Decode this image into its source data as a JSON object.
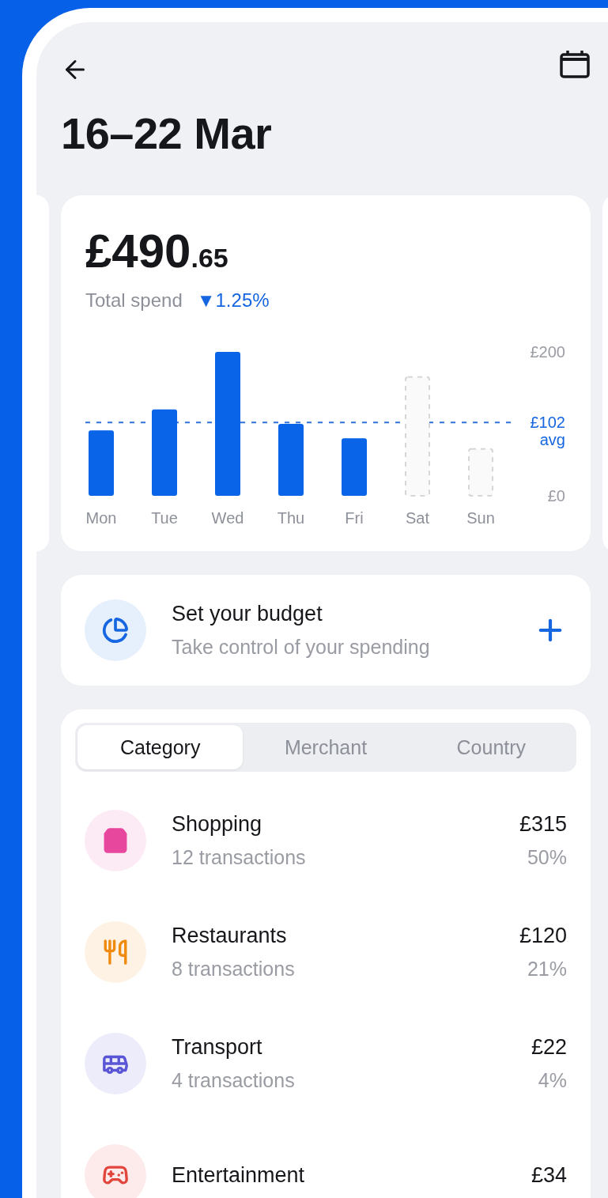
{
  "header": {
    "title": "16–22 Mar"
  },
  "summary": {
    "amount_main": "£490",
    "amount_cents": ".65",
    "label": "Total spend",
    "change": "▼1.25%",
    "chart_data": {
      "type": "bar",
      "categories": [
        "Mon",
        "Tue",
        "Wed",
        "Thu",
        "Fri",
        "Sat",
        "Sun"
      ],
      "ylim": [
        0,
        200
      ],
      "yticks": [
        {
          "value": 0,
          "label": "£0"
        },
        {
          "value": 102,
          "label": "£102"
        },
        {
          "value": 200,
          "label": "£200"
        }
      ],
      "series": [
        {
          "color": "#0a64e8",
          "values": [
            91,
            120,
            200,
            100,
            80,
            null,
            null
          ]
        },
        {
          "color": "#d6d6d6",
          "values": [
            null,
            null,
            null,
            null,
            null,
            165,
            65
          ]
        }
      ],
      "ref_lines": [
        {
          "axis": "y",
          "value": 102,
          "label": "avg",
          "color": "#2f6fd6"
        }
      ]
    }
  },
  "budget": {
    "title": "Set your budget",
    "subtitle": "Take control of your spending"
  },
  "tabs": [
    {
      "label": "Category",
      "selected": true
    },
    {
      "label": "Merchant",
      "selected": false
    },
    {
      "label": "Country",
      "selected": false
    }
  ],
  "categories": [
    {
      "kind": "shopping",
      "color": "#e8479e",
      "name": "Shopping",
      "count": "12 transactions",
      "amount": "£315",
      "share": "50%"
    },
    {
      "kind": "restaurants",
      "color": "#f08a0c",
      "name": "Restaurants",
      "count": "8 transactions",
      "amount": "£120",
      "share": "21%"
    },
    {
      "kind": "transport",
      "color": "#5a55d6",
      "name": "Transport",
      "count": "4 transactions",
      "amount": "£22",
      "share": "4%"
    },
    {
      "kind": "entertainment",
      "color": "#e2453c",
      "name": "Entertainment",
      "amount": "£34"
    }
  ]
}
